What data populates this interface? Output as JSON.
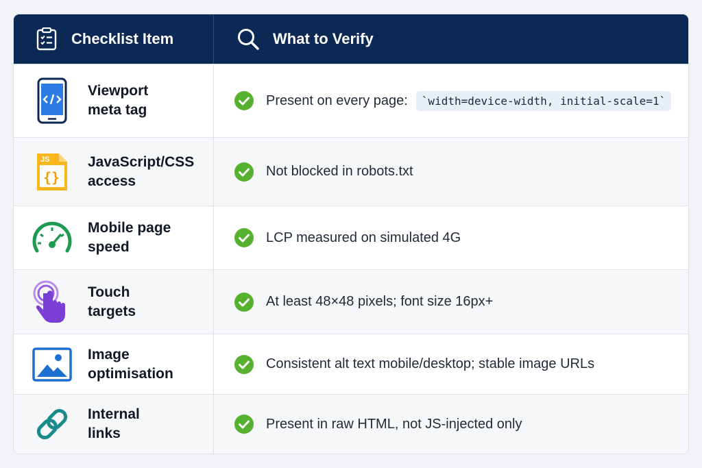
{
  "header": {
    "col1_label": "Checklist Item",
    "col1_icon": "clipboard-checklist-icon",
    "col2_label": "What to Verify",
    "col2_icon": "search-icon"
  },
  "rows": [
    {
      "item": "Viewport\nmeta tag",
      "icon": "mobile-code-icon",
      "verify": "Present on every page:",
      "code": "`width=device-width, initial-scale=1`"
    },
    {
      "item": "JavaScript/CSS\naccess",
      "icon": "js-file-icon",
      "verify": "Not blocked in robots.txt"
    },
    {
      "item": "Mobile page\nspeed",
      "icon": "speedometer-icon",
      "verify": "LCP measured on simulated 4G"
    },
    {
      "item": "Touch\ntargets",
      "icon": "touch-hand-icon",
      "verify": "At least 48×48 pixels; font size 16px+"
    },
    {
      "item": "Image\noptimisation",
      "icon": "image-icon",
      "verify": "Consistent alt text mobile/desktop; stable image URLs"
    },
    {
      "item": "Internal\nlinks",
      "icon": "link-icon",
      "verify": "Present in raw HTML, not JS-injected only"
    }
  ],
  "colors": {
    "header_bg": "#0c2854",
    "check_green": "#56b12e"
  }
}
